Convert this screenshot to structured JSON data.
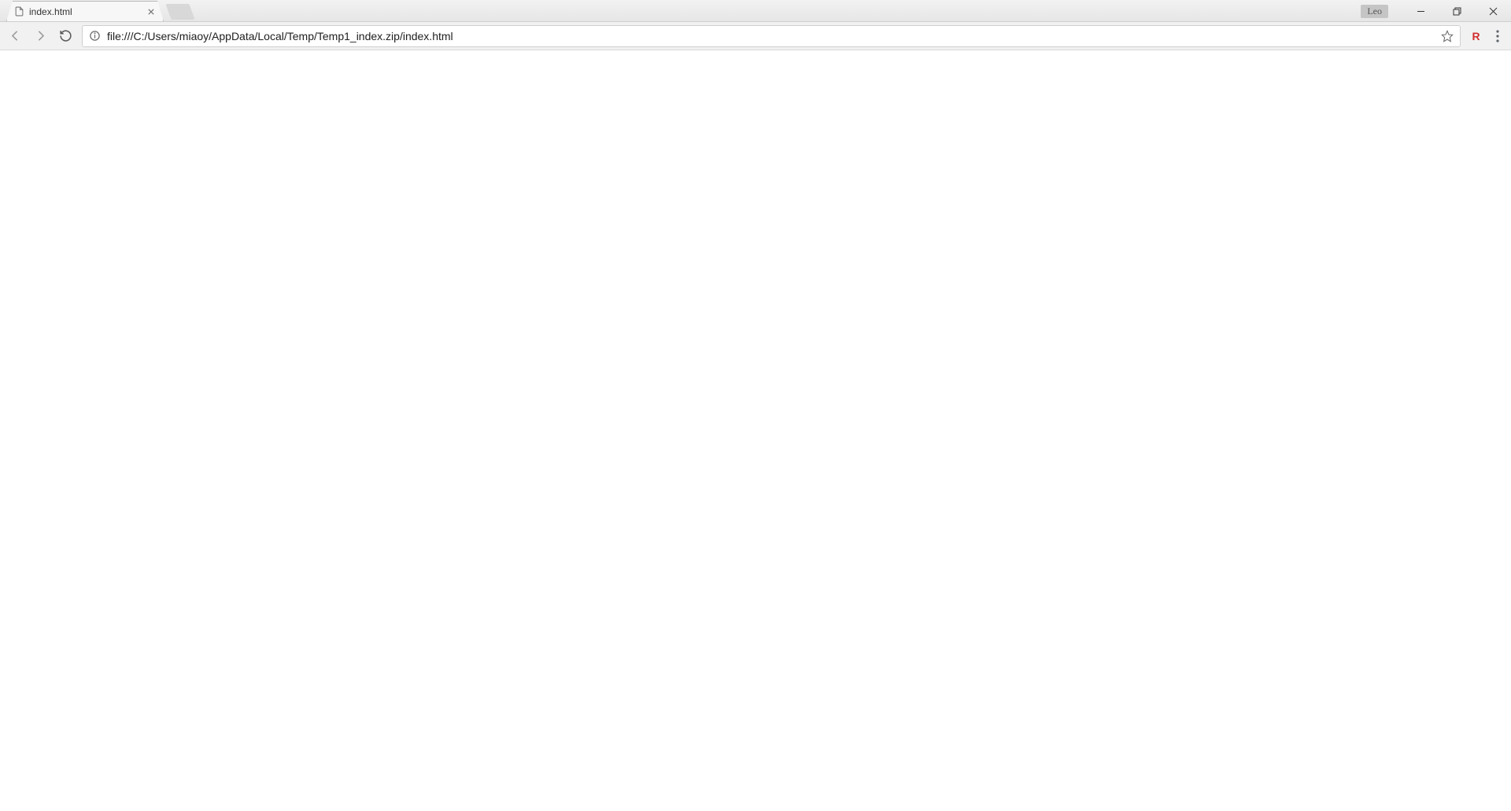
{
  "tab": {
    "title": "index.html"
  },
  "user_badge": "Leo",
  "address_bar": {
    "url": "file:///C:/Users/miaoy/AppData/Local/Temp/Temp1_index.zip/index.html"
  },
  "extension": {
    "label": "R"
  }
}
